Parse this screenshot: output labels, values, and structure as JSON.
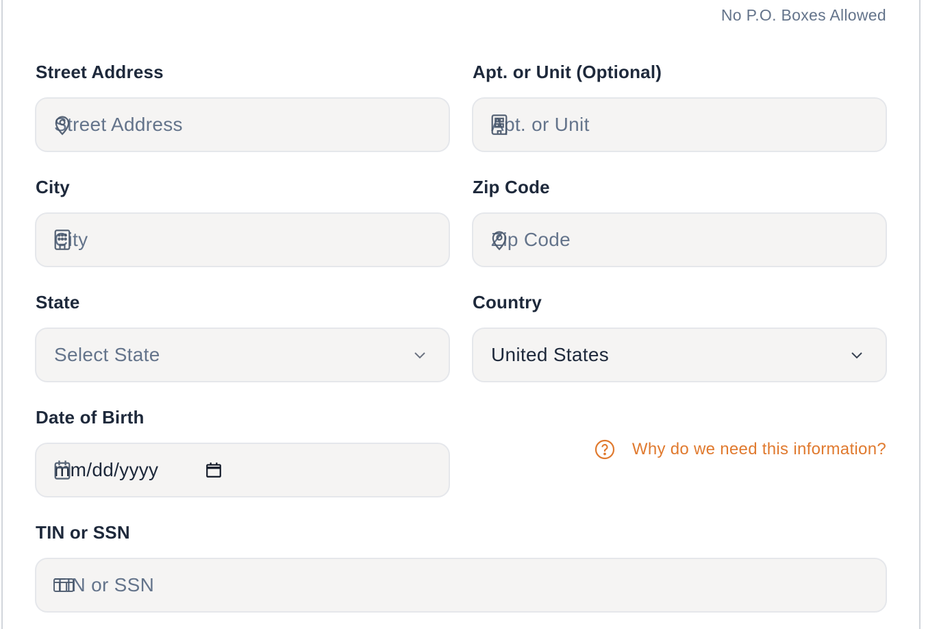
{
  "address_note": "No P.O. Boxes Allowed",
  "street": {
    "label": "Street Address",
    "placeholder": "Street Address",
    "icon": "map-pin-icon"
  },
  "apt": {
    "label": "Apt. or Unit (Optional)",
    "placeholder": "Apt. or Unit",
    "icon": "building-icon"
  },
  "city": {
    "label": "City",
    "placeholder": "City",
    "icon": "city-building-icon"
  },
  "zip": {
    "label": "Zip Code",
    "placeholder": "Zip Code",
    "icon": "map-pin-icon"
  },
  "state": {
    "label": "State",
    "placeholder": "Select State",
    "icon": "chevron-down-icon"
  },
  "country": {
    "label": "Country",
    "value": "United States",
    "icon": "chevron-down-icon"
  },
  "dob": {
    "label": "Date of Birth",
    "placeholder": "mm/dd/yyyy",
    "icon": "calendar-icon"
  },
  "help": {
    "text": "Why do we need this information?",
    "icon": "question-circle-icon",
    "color": "#e07a2f"
  },
  "tin": {
    "label": "TIN or SSN",
    "placeholder": "TIN or SSN",
    "icon": "id-card-icon"
  },
  "colors": {
    "field_bg": "#f5f4f3",
    "label": "#1e293b",
    "placeholder": "#64748b",
    "accent": "#e07a2f"
  }
}
